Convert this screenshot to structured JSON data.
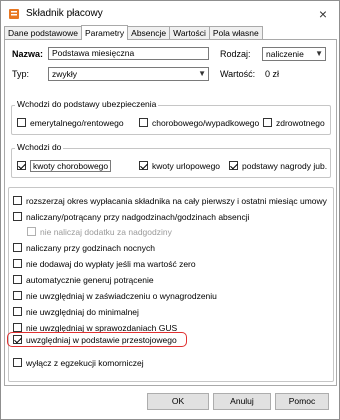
{
  "window": {
    "title": "Składnik płacowy",
    "icon_name": "app-icon",
    "close_icon": "×"
  },
  "tabs": [
    {
      "label": "Dane podstawowe",
      "active": false
    },
    {
      "label": "Parametry",
      "active": true
    },
    {
      "label": "Absencje",
      "active": false
    },
    {
      "label": "Wartości",
      "active": false
    },
    {
      "label": "Pola własne",
      "active": false
    }
  ],
  "form": {
    "name_label": "Nazwa:",
    "name_value": "Podstawa miesięczna",
    "type_label": "Typ:",
    "type_value": "zwykły",
    "kind_label": "Rodzaj:",
    "kind_value": "naliczenie",
    "value_label": "Wartość:",
    "value_value": "0 zł"
  },
  "insurance_group": {
    "title": "Wchodzi do podstawy ubezpieczenia",
    "items": [
      {
        "label": "emerytalnego/rentowego",
        "checked": false
      },
      {
        "label": "chorobowego/wypadkowego",
        "checked": false
      },
      {
        "label": "zdrowotnego",
        "checked": false
      }
    ]
  },
  "base_group": {
    "title": "Wchodzi do",
    "items": [
      {
        "label": "kwoty chorobowego",
        "checked": true
      },
      {
        "label": "kwoty urlopowego",
        "checked": true
      },
      {
        "label": "podstawy nagrody jub.",
        "checked": true
      }
    ]
  },
  "options": [
    {
      "label": "rozszerzaj okres wypłacania składnika na cały pierwszy i ostatni miesiąc umowy",
      "checked": false,
      "disabled": false
    },
    {
      "label": "naliczany/potrącany przy nadgodzinach/godzinach absencji",
      "checked": false,
      "disabled": false
    },
    {
      "label": "nie naliczaj dodatku za nadgodziny",
      "checked": false,
      "disabled": true
    },
    {
      "label": "naliczany przy godzinach nocnych",
      "checked": false,
      "disabled": false
    },
    {
      "label": "nie dodawaj do wypłaty jeśli ma wartość zero",
      "checked": false,
      "disabled": false
    },
    {
      "label": "automatycznie generuj potrącenie",
      "checked": false,
      "disabled": false
    },
    {
      "label": "nie uwzględniaj w zaświadczeniu o wynagrodzeniu",
      "checked": false,
      "disabled": false
    },
    {
      "label": "nie uwzględniaj do minimalnej",
      "checked": false,
      "disabled": false
    },
    {
      "label": "nie uwzględniaj w sprawozdaniach GUS",
      "checked": false,
      "disabled": false
    },
    {
      "label": "uwzględniaj w podstawie przestojowego",
      "checked": true,
      "disabled": false
    },
    {
      "label": "wyłącz z egzekucji komorniczej",
      "checked": false,
      "disabled": false
    }
  ],
  "buttons": {
    "ok": "OK",
    "cancel": "Anuluj",
    "help": "Pomoc"
  },
  "colors": {
    "highlight": "#e03030",
    "window_bg": "#ffffff",
    "button_bg": "#e1e1e1"
  }
}
